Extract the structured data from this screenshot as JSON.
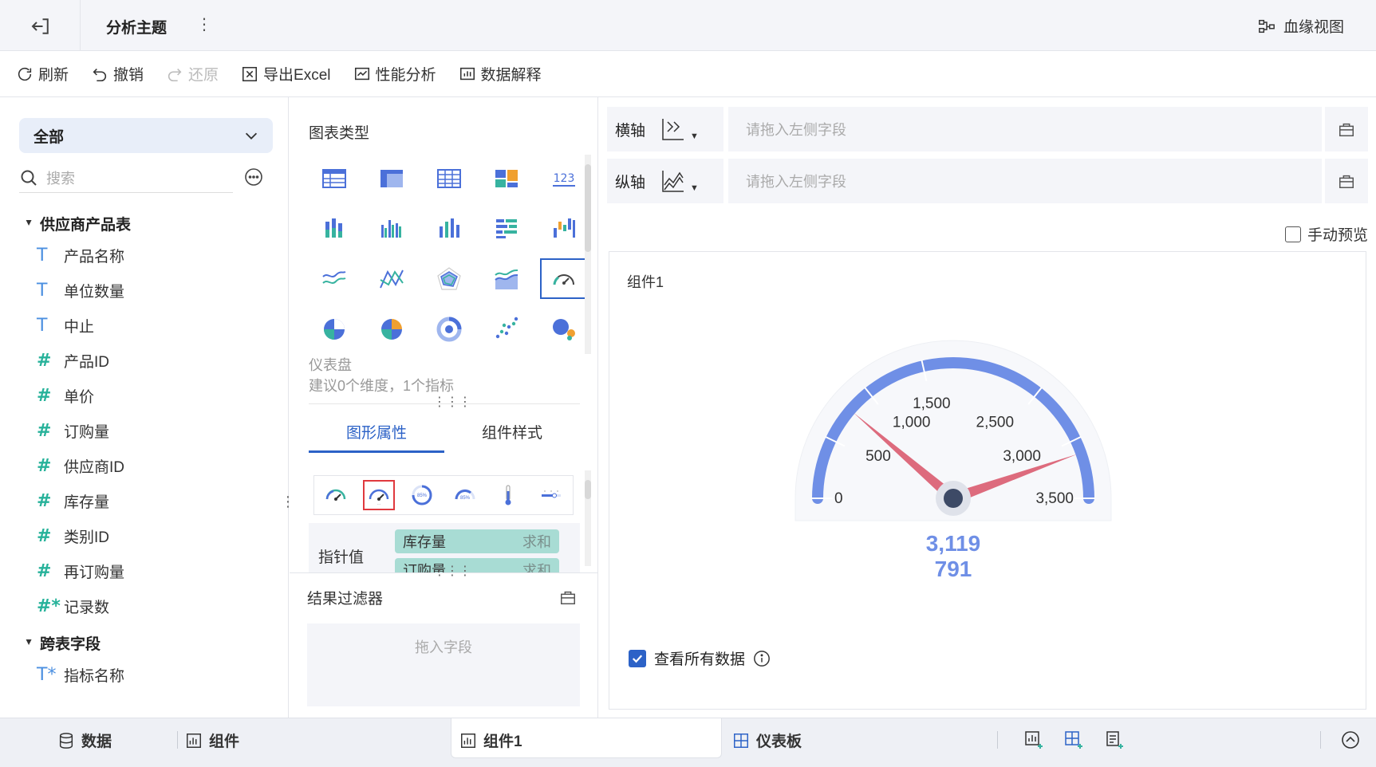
{
  "topbar": {
    "title": "分析主题",
    "lineage_label": "血缘视图"
  },
  "toolbar": {
    "refresh": "刷新",
    "undo": "撤销",
    "redo": "还原",
    "export": "导出Excel",
    "perf": "性能分析",
    "explain": "数据解释"
  },
  "left": {
    "dropdown_value": "全部",
    "search_placeholder": "搜索",
    "groups": [
      {
        "name": "供应商产品表",
        "fields": [
          {
            "type": "T",
            "name": "产品名称"
          },
          {
            "type": "T",
            "name": "单位数量"
          },
          {
            "type": "T",
            "name": "中止"
          },
          {
            "type": "#",
            "name": "产品ID"
          },
          {
            "type": "#",
            "name": "单价"
          },
          {
            "type": "#",
            "name": "订购量"
          },
          {
            "type": "#",
            "name": "供应商ID"
          },
          {
            "type": "#",
            "name": "库存量"
          },
          {
            "type": "#",
            "name": "类别ID"
          },
          {
            "type": "#",
            "name": "再订购量"
          },
          {
            "type": "#*",
            "name": "记录数"
          }
        ]
      },
      {
        "name": "跨表字段",
        "fields": [
          {
            "type": "T*",
            "name": "指标名称"
          }
        ]
      }
    ]
  },
  "middle": {
    "chart_type_heading": "图表类型",
    "selected_chart_name": "仪表盘",
    "selected_chart_hint": "建议0个维度，1个指标",
    "chart_icons": [
      "table-icon",
      "cross-table-icon",
      "detail-table-icon",
      "treemap-icon",
      "kpi-icon",
      "stacked-bar-icon",
      "grouped-bar-icon",
      "bar-icon",
      "strip-icon",
      "waterfall-icon",
      "line-icon",
      "multi-line-icon",
      "radar-icon",
      "area-icon",
      "gauge-icon",
      "pie-icon",
      "multi-pie-icon",
      "ring-icon",
      "scatter-icon",
      "bubble-icon"
    ],
    "kpi_text": "123",
    "tabs": [
      "图形属性",
      "组件样式"
    ],
    "pointer_label": "指针值",
    "pointer_fields": [
      {
        "name": "库存量",
        "agg": "求和"
      },
      {
        "name": "订购量",
        "agg": "求和"
      }
    ],
    "filter_title": "结果过滤器",
    "filter_drop": "拖入字段"
  },
  "right": {
    "x_axis_label": "横轴",
    "y_axis_label": "纵轴",
    "axis_placeholder": "请拖入左侧字段",
    "manual_preview": "手动预览",
    "component_title": "组件1",
    "view_all_label": "查看所有数据"
  },
  "chart_data": {
    "type": "gauge",
    "min": 0,
    "max": 3500,
    "ticks": [
      "0",
      "500",
      "1,000",
      "1,500",
      "2,500",
      "3,000",
      "3,500"
    ],
    "tick_values": [
      0,
      500,
      1000,
      1500,
      2500,
      3000,
      3500
    ],
    "pointers": [
      {
        "value": 3119,
        "label": "3,119"
      },
      {
        "value": 791,
        "label": "791"
      }
    ],
    "arc_color": "#6f8fe6",
    "pointer_color": "#dd6b7d",
    "value_color": "#6f8fe6"
  },
  "bottom": {
    "data_tab": "数据",
    "component_tab": "组件",
    "active_tab": "组件1",
    "dashboard_tab": "仪表板"
  }
}
